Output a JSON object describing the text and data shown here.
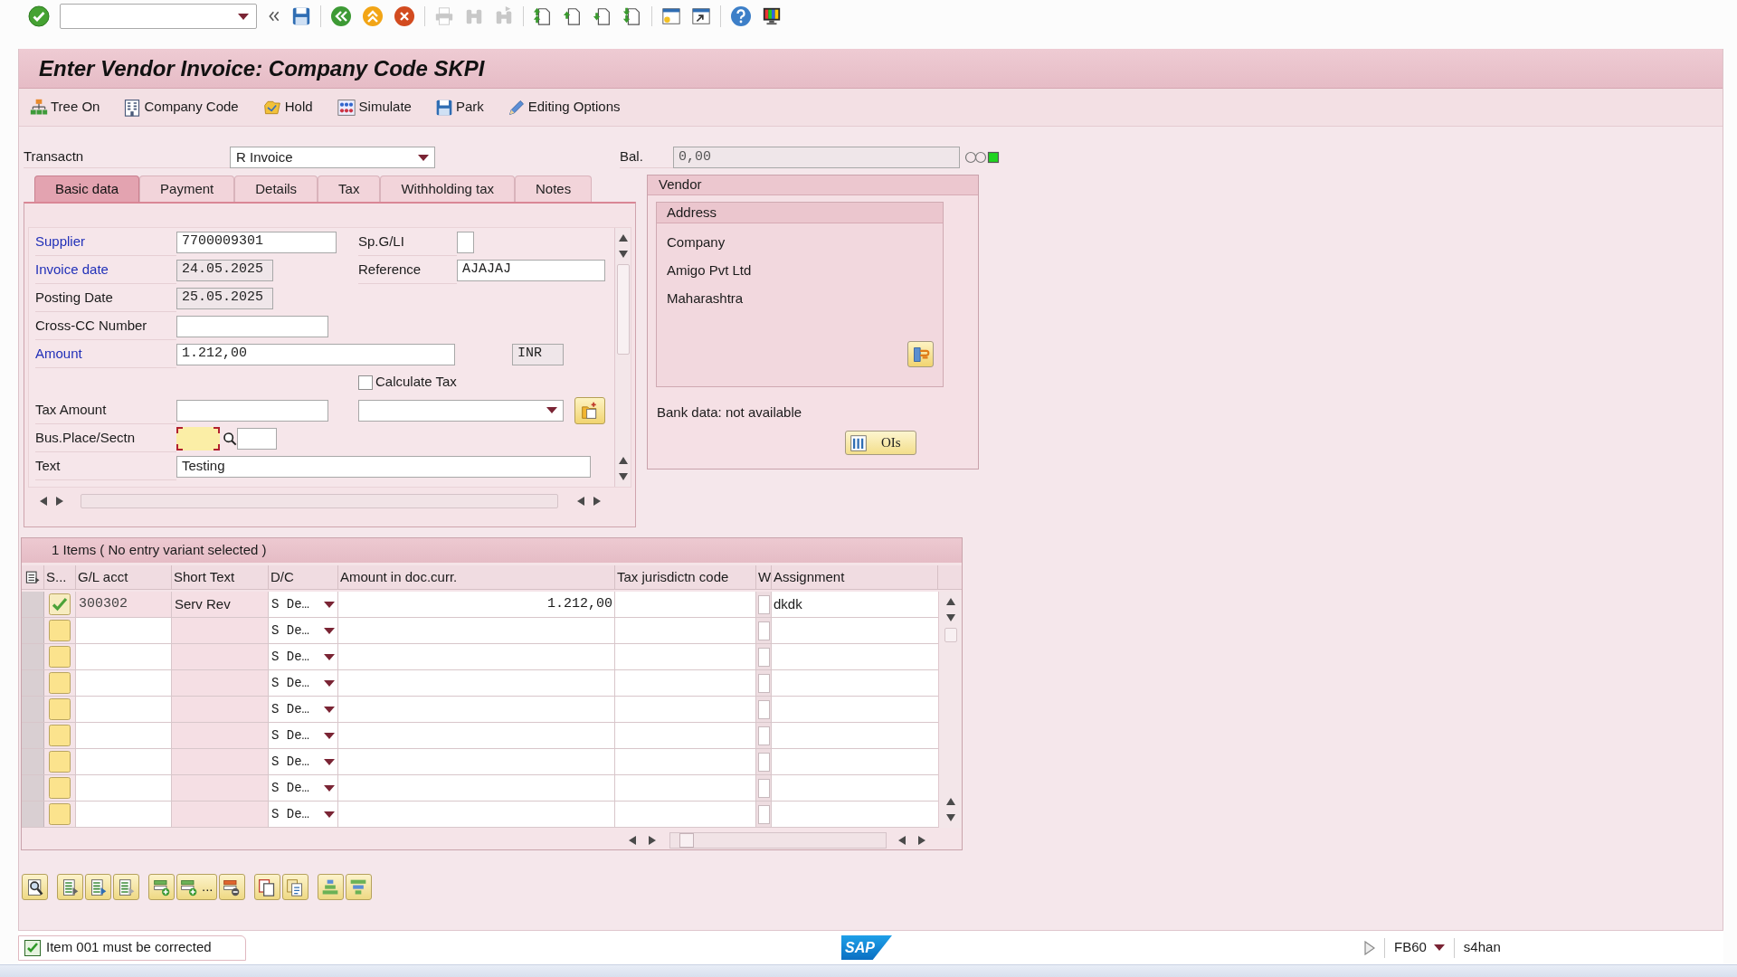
{
  "system_toolbar": {
    "groups": [
      [
        {
          "kind": "enter",
          "disabled": false
        },
        {
          "kind": "command_field",
          "disabled": false
        },
        {
          "kind": "collapse",
          "disabled": false
        },
        {
          "kind": "save",
          "disabled": false
        }
      ],
      [
        {
          "kind": "back",
          "disabled": false
        },
        {
          "kind": "exit",
          "disabled": false
        },
        {
          "kind": "cancel",
          "disabled": false
        }
      ],
      [
        {
          "kind": "print",
          "disabled": true
        },
        {
          "kind": "find",
          "disabled": true
        },
        {
          "kind": "find_next",
          "disabled": true
        }
      ],
      [
        {
          "kind": "first_page",
          "disabled": false
        },
        {
          "kind": "previous_page",
          "disabled": false
        },
        {
          "kind": "next_page",
          "disabled": false
        },
        {
          "kind": "last_page",
          "disabled": false
        }
      ],
      [
        {
          "kind": "new_session",
          "disabled": false
        },
        {
          "kind": "shortcut",
          "disabled": false
        }
      ],
      [
        {
          "kind": "help",
          "disabled": false
        },
        {
          "kind": "customize",
          "disabled": false
        }
      ]
    ]
  },
  "title": "Enter Vendor Invoice: Company Code SKPI",
  "app_toolbar": [
    {
      "kind": "tree",
      "label": "Tree On"
    },
    {
      "kind": "company_code",
      "label": "Company Code"
    },
    {
      "kind": "hold",
      "label": "Hold"
    },
    {
      "kind": "simulate",
      "label": "Simulate"
    },
    {
      "kind": "park",
      "label": "Park"
    },
    {
      "kind": "editing_options",
      "label": "Editing Options"
    }
  ],
  "transaction": {
    "label": "Transactn",
    "value": "R Invoice"
  },
  "balance": {
    "label": "Bal.",
    "value": "0,00",
    "balanced": true
  },
  "tabs": [
    {
      "label": "Basic data",
      "selected": true
    },
    {
      "label": "Payment",
      "selected": false
    },
    {
      "label": "Details",
      "selected": false
    },
    {
      "label": "Tax",
      "selected": false
    },
    {
      "label": "Withholding tax",
      "selected": false
    },
    {
      "label": "Notes",
      "selected": false
    }
  ],
  "basic_data": {
    "supplier": {
      "label": "Supplier",
      "link": true,
      "value": "7700009301"
    },
    "special_gl": {
      "label": "Sp.G/LI",
      "link": false
    },
    "invoice_date": {
      "label": "Invoice date",
      "link": true,
      "value": "24.05.2025"
    },
    "reference": {
      "label": "Reference",
      "link": false,
      "value": "AJAJAJ"
    },
    "posting_date": {
      "label": "Posting Date",
      "link": false,
      "value": "25.05.2025"
    },
    "cross_cc_number": {
      "label": "Cross-CC Number",
      "link": false
    },
    "amount": {
      "label": "Amount",
      "link": true,
      "value": "1.212,00",
      "currency": "INR"
    },
    "calculate_tax": {
      "label": "Calculate Tax",
      "checked": false
    },
    "tax_amount": {
      "label": "Tax Amount",
      "link": false
    },
    "bus_place": {
      "label": "Bus.Place/Sectn",
      "link": false,
      "error": true
    },
    "text": {
      "label": "Text",
      "link": false,
      "value": "Testing"
    }
  },
  "vendor": {
    "title": "Vendor",
    "address": {
      "title": "Address",
      "lines": [
        "Company",
        "Amigo Pvt Ltd",
        "Maharashtra"
      ]
    },
    "bank_data": "Bank data: not available",
    "items_button": "OIs"
  },
  "items_table": {
    "title": "1 Items ( No entry variant selected )",
    "columns": [
      "S...",
      "G/L acct",
      "Short Text",
      "D/C",
      "Amount in doc.curr.",
      "Tax jurisdictn code",
      "W",
      "Assignment"
    ],
    "rows": [
      {
        "kind": "ok",
        "gl_account": "300302",
        "short_text": "Serv Rev",
        "dc": "S De…",
        "amount": "1.212,00",
        "assignment": "dkdk"
      },
      {
        "kind": "empty",
        "dc": "S De…"
      },
      {
        "kind": "empty",
        "dc": "S De…"
      },
      {
        "kind": "empty",
        "dc": "S De…"
      },
      {
        "kind": "empty",
        "dc": "S De…"
      },
      {
        "kind": "empty",
        "dc": "S De…"
      },
      {
        "kind": "empty",
        "dc": "S De…"
      },
      {
        "kind": "empty",
        "dc": "S De…"
      },
      {
        "kind": "empty",
        "dc": "S De…"
      }
    ]
  },
  "bottom_toolbar": [
    [
      {
        "kind": "details"
      }
    ],
    [
      {
        "kind": "select_all"
      },
      {
        "kind": "select_block"
      },
      {
        "kind": "deselect_all"
      }
    ],
    [
      {
        "kind": "insert_row"
      },
      {
        "kind": "insert_rows",
        "label": "..."
      },
      {
        "kind": "delete_row"
      }
    ],
    [
      {
        "kind": "copy"
      },
      {
        "kind": "paste"
      }
    ],
    [
      {
        "kind": "sort"
      },
      {
        "kind": "filter"
      }
    ]
  ],
  "status_bar": {
    "message": {
      "kind": "success",
      "text": "Item 001 must be corrected"
    },
    "logo": "SAP",
    "transaction": "FB60",
    "system": "s4han"
  }
}
